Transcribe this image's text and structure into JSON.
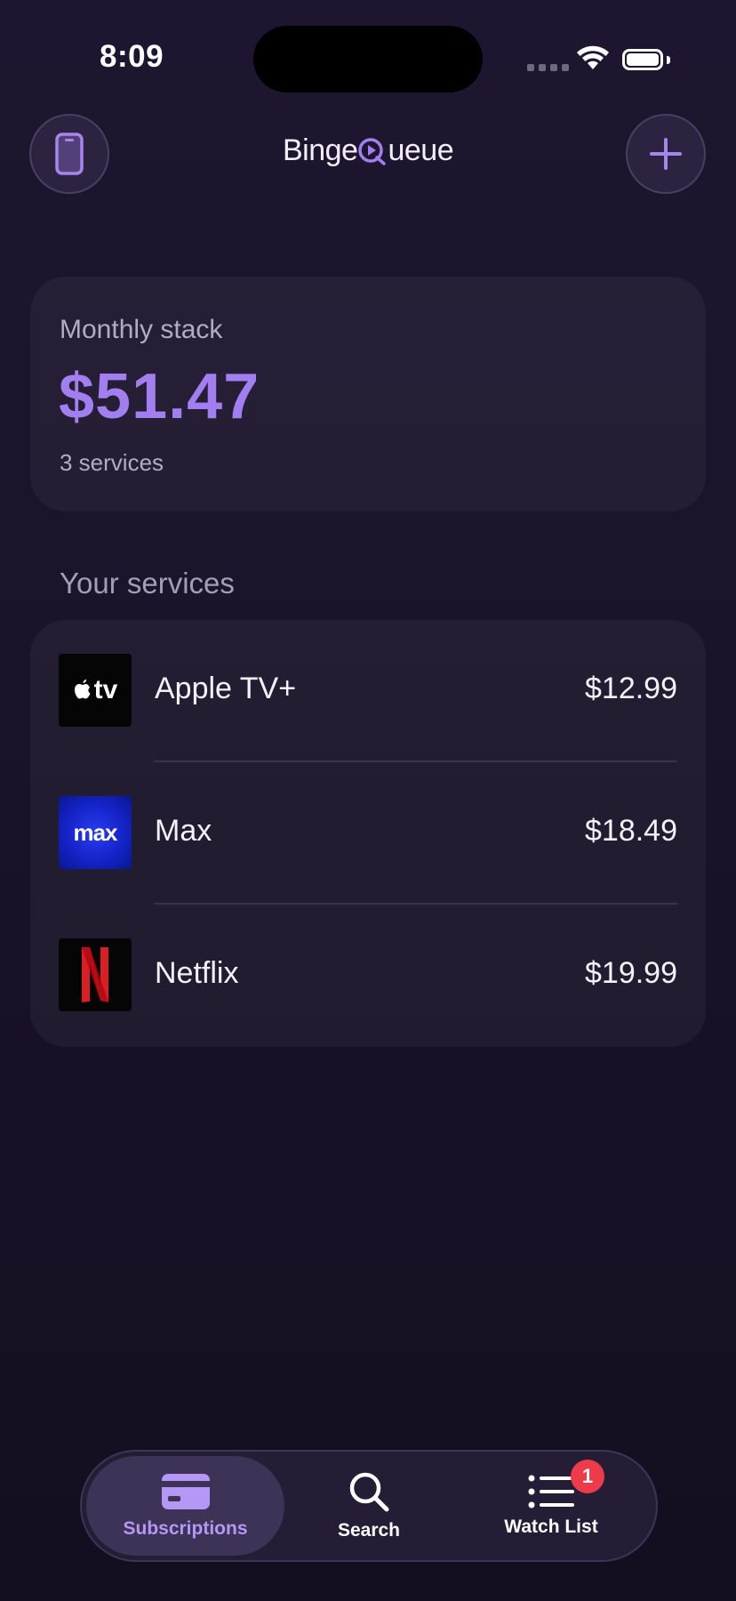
{
  "status_bar": {
    "time": "8:09",
    "icons": [
      "signal-icon",
      "wifi-icon",
      "battery-icon"
    ]
  },
  "header": {
    "logo_prefix": "Binge",
    "logo_q": "Q",
    "logo_suffix": "ueue",
    "left_button_icon": "phone-icon",
    "right_button_icon": "plus-icon"
  },
  "summary": {
    "label": "Monthly stack",
    "amount": "$51.47",
    "count": "3 services"
  },
  "services_section": {
    "title": "Your services",
    "items": [
      {
        "name": "Apple TV+",
        "price": "$12.99",
        "logo_text": "tv",
        "icon": "apple-tv-logo"
      },
      {
        "name": "Max",
        "price": "$18.49",
        "logo_text": "max",
        "icon": "max-logo"
      },
      {
        "name": "Netflix",
        "price": "$19.99",
        "logo_text": "",
        "icon": "netflix-logo"
      }
    ]
  },
  "tabs": [
    {
      "label": "Subscriptions",
      "icon": "credit-card-icon",
      "active": true
    },
    {
      "label": "Search",
      "icon": "search-icon",
      "active": false
    },
    {
      "label": "Watch List",
      "icon": "list-icon",
      "active": false,
      "badge": "1"
    }
  ],
  "colors": {
    "accent": "#a27ff0",
    "background": "#1a1329",
    "badge": "#ee3b4a"
  }
}
